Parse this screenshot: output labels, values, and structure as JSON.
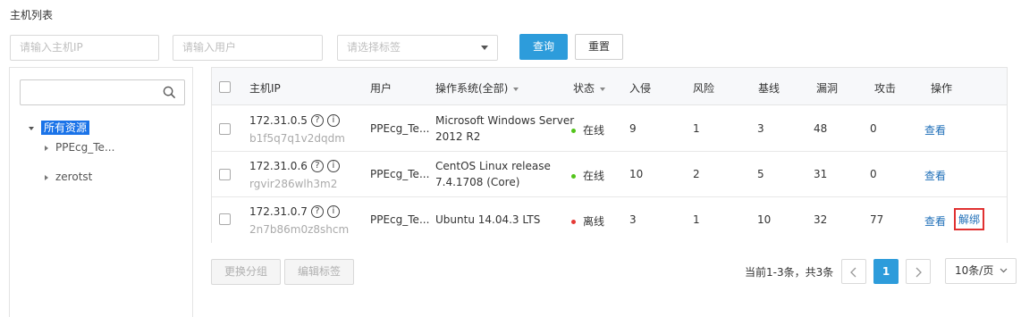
{
  "page": {
    "title": "主机列表"
  },
  "filters": {
    "ip_placeholder": "请输入主机IP",
    "user_placeholder": "请输入用户",
    "tag_placeholder": "请选择标签",
    "query_label": "查询",
    "reset_label": "重置"
  },
  "tree": {
    "root_label": "所有资源",
    "children": [
      "PPEcg_Te...",
      "zerotst"
    ]
  },
  "table": {
    "headers": {
      "ip": "主机IP",
      "user": "用户",
      "os": "操作系统(全部)",
      "status": "状态",
      "intrusion": "入侵",
      "risk": "风险",
      "baseline": "基线",
      "vuln": "漏洞",
      "attack": "攻击",
      "actions": "操作"
    },
    "rows": [
      {
        "ip": "172.31.0.5",
        "id": "b1f5q7q1v2dqdm",
        "user": "PPEcg_Te...",
        "os_line1": "Microsoft Windows Server",
        "os_line2": "2012 R2",
        "status": "在线",
        "status_color": "#52c41a",
        "intrusion": "9",
        "risk": "1",
        "baseline": "3",
        "vuln": "48",
        "attack": "0",
        "view": "查看"
      },
      {
        "ip": "172.31.0.6",
        "id": "rgvir286wlh3m2",
        "user": "PPEcg_Te...",
        "os_line1": "CentOS Linux release",
        "os_line2": "7.4.1708 (Core)",
        "status": "在线",
        "status_color": "#52c41a",
        "intrusion": "10",
        "risk": "2",
        "baseline": "5",
        "vuln": "31",
        "attack": "0",
        "view": "查看"
      },
      {
        "ip": "172.31.0.7",
        "id": "2n7b86m0z8shcm",
        "user": "PPEcg_Te...",
        "os_line1": "Ubuntu 14.04.3 LTS",
        "os_line2": "",
        "status": "离线",
        "status_color": "#e53935",
        "intrusion": "3",
        "risk": "1",
        "baseline": "10",
        "vuln": "32",
        "attack": "77",
        "view": "查看",
        "unbind": "解绑"
      }
    ]
  },
  "footer": {
    "change_group": "更换分组",
    "edit_tags": "编辑标签",
    "summary": "当前1-3条，共3条",
    "current_page": "1",
    "page_size": "10条/页"
  },
  "icons": {
    "search": "search-icon",
    "help": "question-circle-icon",
    "info": "info-circle-icon"
  },
  "colors": {
    "primary": "#2d9cdb",
    "tree_selected": "#1a73e8",
    "link": "#1f6fb8",
    "online": "#52c41a",
    "offline": "#e53935",
    "highlight_box": "#e03131"
  }
}
